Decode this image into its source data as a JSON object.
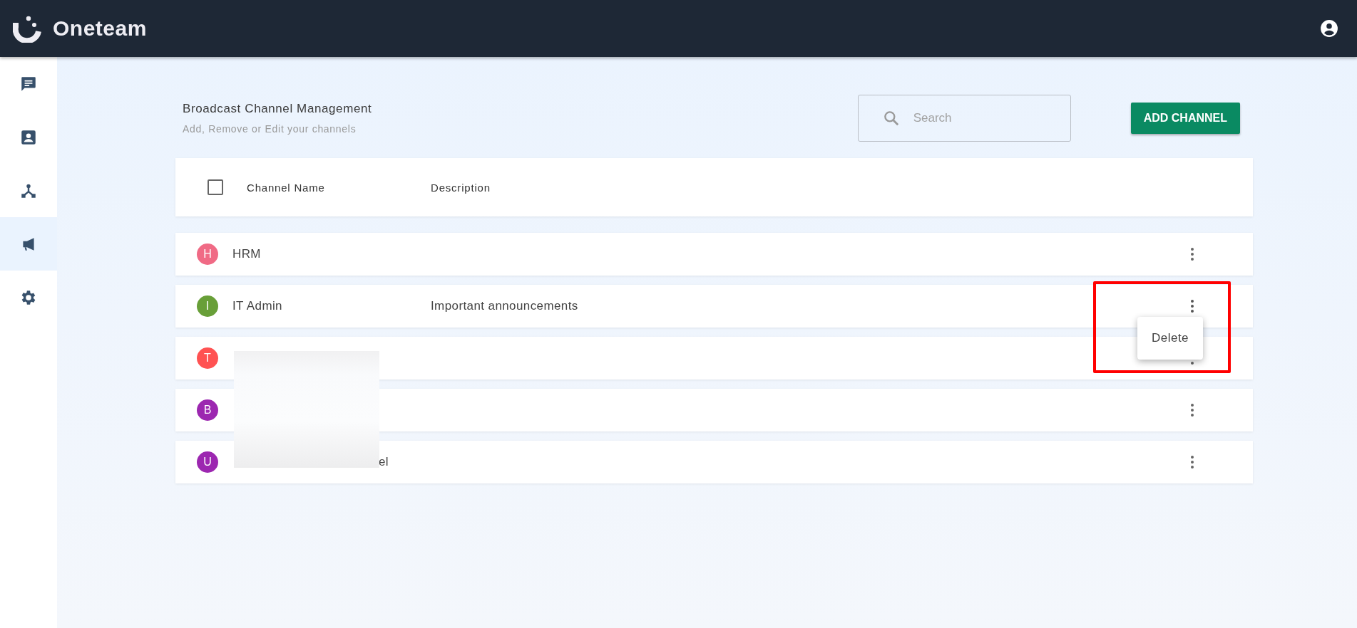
{
  "app": {
    "name": "Oneteam"
  },
  "sidebar": {
    "items": [
      {
        "selected": false
      },
      {
        "selected": false
      },
      {
        "selected": false
      },
      {
        "selected": true
      },
      {
        "selected": false
      }
    ]
  },
  "page": {
    "title": "Broadcast Channel Management",
    "subtitle": "Add, Remove or Edit your channels"
  },
  "search": {
    "placeholder": "Search"
  },
  "add_button": "ADD CHANNEL",
  "table": {
    "select_all": {
      "checked": false
    },
    "columns": [
      "Channel Name",
      "Description"
    ],
    "rows": [
      {
        "initial": "H",
        "color": "#f06a85",
        "name": "HRM",
        "description": "",
        "menu_open": false
      },
      {
        "initial": "I",
        "color": "#689f38",
        "name": "IT Admin",
        "description": "Important announcements",
        "menu_open": true
      },
      {
        "initial": "T",
        "color": "#ff5252",
        "name": "",
        "description": "",
        "menu_open": false
      },
      {
        "initial": "B",
        "color": "#9c27b0",
        "name": "",
        "description": "",
        "menu_open": false
      },
      {
        "initial": "U",
        "color": "#9c27b0",
        "name": "el",
        "description": "",
        "menu_open": false
      }
    ],
    "redacted": true
  },
  "row_menu": {
    "items": [
      "Delete"
    ]
  }
}
